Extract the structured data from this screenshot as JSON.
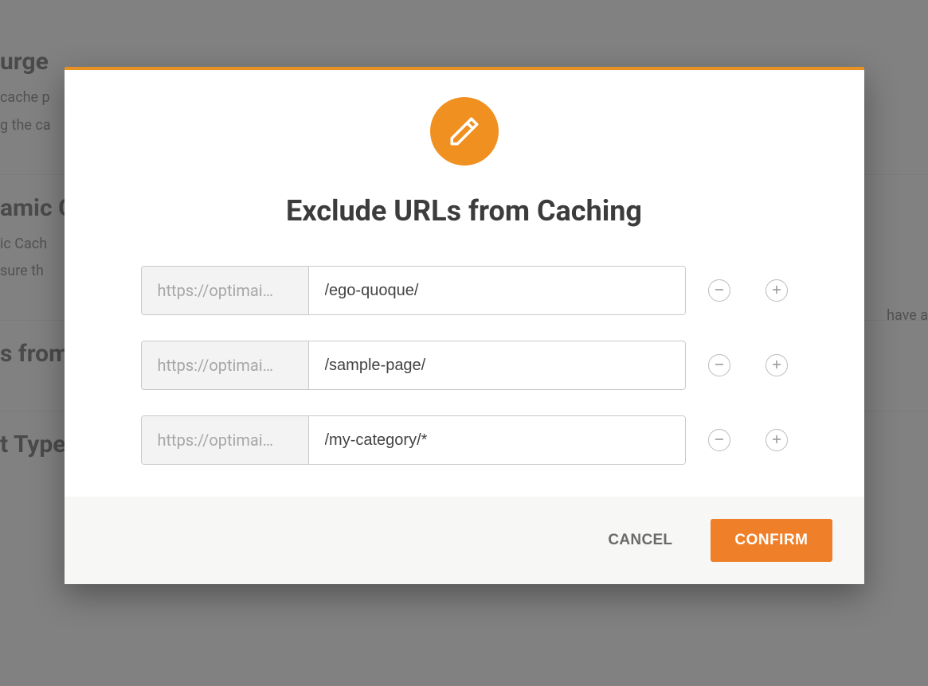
{
  "colors": {
    "accent": "#ef7f28",
    "accent_dark": "#e99022",
    "overlay": "rgba(80,80,80,0.72)"
  },
  "background": {
    "sections": [
      {
        "heading": "urge",
        "lines": [
          "cache p",
          "g the ca"
        ]
      },
      {
        "heading": "amic C",
        "lines": [
          "ic Cach",
          "sure th"
        ]
      },
      {
        "heading": "s from",
        "lines": []
      },
      {
        "heading": "t Type",
        "lines": []
      }
    ],
    "right_fragment": "have au"
  },
  "dialog": {
    "icon": "pencil-icon",
    "title": "Exclude URLs from Caching",
    "prefix_display": "https://optimai…",
    "rows": [
      {
        "value": "/ego-quoque/"
      },
      {
        "value": "/sample-page/"
      },
      {
        "value": "/my-category/*"
      }
    ],
    "buttons": {
      "cancel": "CANCEL",
      "confirm": "CONFIRM"
    }
  }
}
